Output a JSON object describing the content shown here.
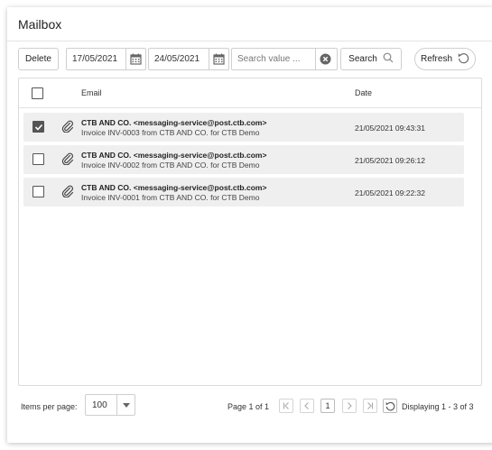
{
  "title": "Mailbox",
  "toolbar": {
    "delete_label": "Delete",
    "date_from": "17/05/2021",
    "date_to": "24/05/2021",
    "search_placeholder": "Search value ...",
    "search_label": "Search",
    "refresh_label": "Refresh"
  },
  "grid": {
    "columns": {
      "email": "Email",
      "date": "Date"
    },
    "rows": [
      {
        "checked": true,
        "from": "CTB AND CO. <messaging-service@post.ctb.com>",
        "subject": "Invoice INV-0003 from CTB AND CO. for CTB Demo",
        "date": "21/05/2021 09:43:31"
      },
      {
        "checked": false,
        "from": "CTB AND CO. <messaging-service@post.ctb.com>",
        "subject": "Invoice INV-0002 from CTB AND CO. for CTB Demo",
        "date": "21/05/2021 09:26:12"
      },
      {
        "checked": false,
        "from": "CTB AND CO. <messaging-service@post.ctb.com>",
        "subject": "Invoice INV-0001 from CTB AND CO. for CTB Demo",
        "date": "21/05/2021 09:22:32"
      }
    ]
  },
  "footer": {
    "items_per_page_label": "Items per page:",
    "items_per_page_value": "100",
    "page_info": "Page 1 of 1",
    "current_page": "1",
    "display_info": "Displaying 1 - 3 of 3"
  },
  "icons": {
    "calendar": "calendar-icon",
    "clear": "clear-circle-icon",
    "search": "magnifier-icon",
    "refresh": "refresh-icon",
    "attachment": "paperclip-icon"
  }
}
